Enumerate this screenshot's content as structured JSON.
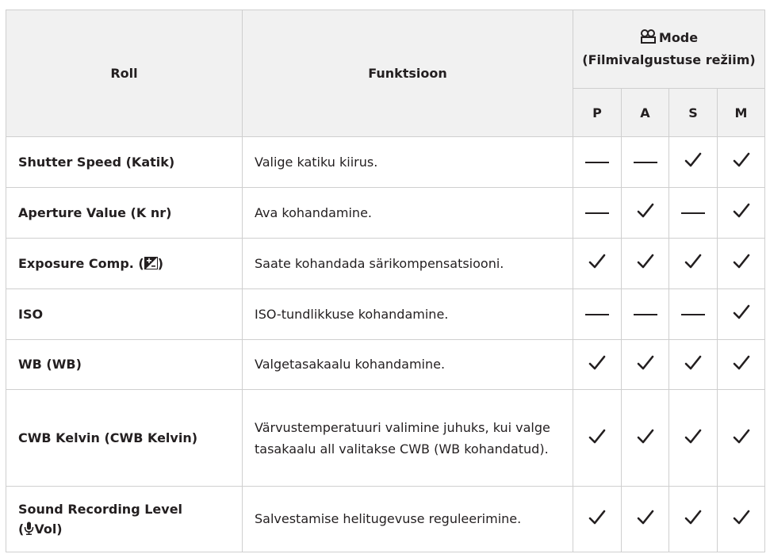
{
  "header": {
    "role": "Roll",
    "function": "Funktsioon",
    "mode_title": "Mode",
    "mode_subtitle": "(Filmivalgustuse režiim)",
    "modes": [
      "P",
      "A",
      "S",
      "M"
    ]
  },
  "rows": [
    {
      "role": "Shutter Speed (Katik)",
      "function": "Valige katiku kiirus.",
      "marks": [
        "dash",
        "dash",
        "check",
        "check"
      ]
    },
    {
      "role": "Aperture Value (K nr)",
      "function": "Ava kohandamine.",
      "marks": [
        "dash",
        "check",
        "dash",
        "check"
      ]
    },
    {
      "role_before_icon": "Exposure Comp. (",
      "role_after_icon": ")",
      "role_icon": "exposure-compensation-icon",
      "function": "Saate kohandada särikompensatsiooni.",
      "marks": [
        "check",
        "check",
        "check",
        "check"
      ]
    },
    {
      "role": "ISO",
      "function": "ISO-tundlikkuse kohandamine.",
      "marks": [
        "dash",
        "dash",
        "dash",
        "check"
      ]
    },
    {
      "role": "WB (WB)",
      "function": "Valgetasakaalu kohandamine.",
      "marks": [
        "check",
        "check",
        "check",
        "check"
      ]
    },
    {
      "role": "CWB Kelvin (CWB Kelvin)",
      "function": "Värvustemperatuuri valimine juhuks, kui valge tasakaalu all valitakse CWB (WB kohandatud).",
      "marks": [
        "check",
        "check",
        "check",
        "check"
      ]
    },
    {
      "role_line1": "Sound Recording Level",
      "role_line2_before": "(",
      "role_line2_after": "Vol)",
      "role_icon": "microphone-icon",
      "function": "Salvestamise helitugevuse reguleerimine.",
      "marks": [
        "check",
        "check",
        "check",
        "check"
      ]
    }
  ],
  "icons": {
    "header_mode": "movie-camera-icon",
    "supported": "check-icon",
    "not_supported": "dash-icon"
  }
}
